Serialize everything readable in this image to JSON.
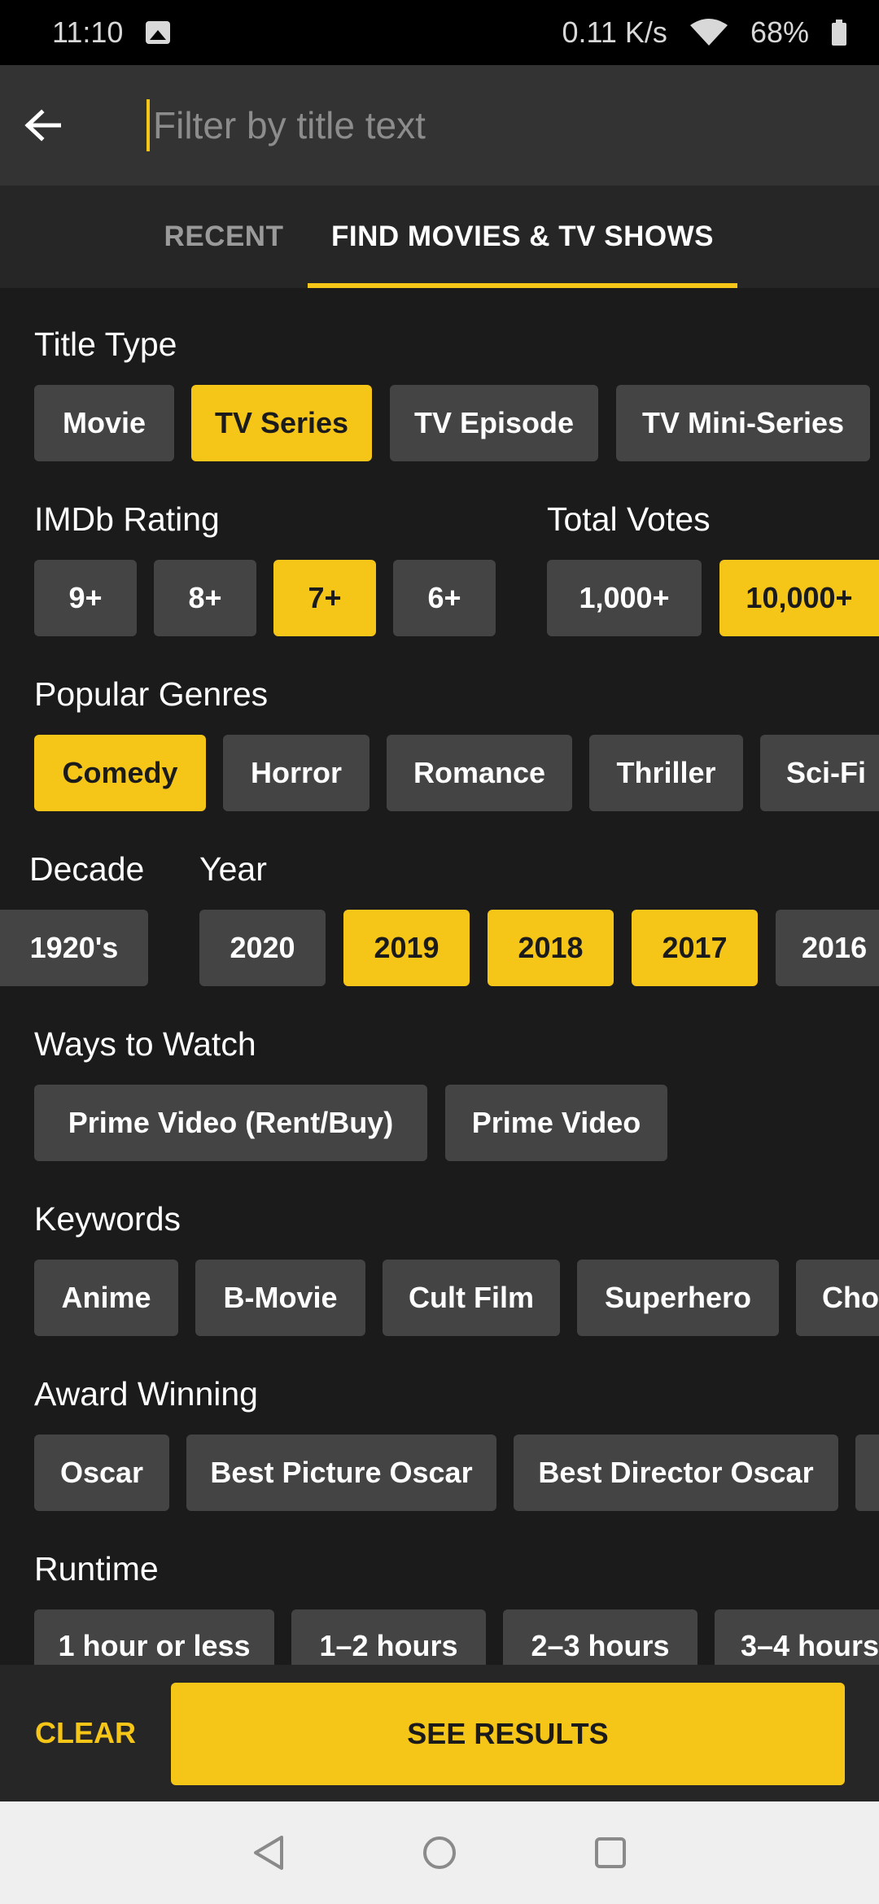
{
  "status_bar": {
    "time": "11:10",
    "speed": "0.11 K/s",
    "battery": "68%",
    "icons": [
      "image-icon",
      "wifi-icon",
      "battery-icon"
    ]
  },
  "search": {
    "placeholder": "Filter by title text",
    "value": ""
  },
  "tabs": [
    {
      "label": "RECENT",
      "selected": false
    },
    {
      "label": "FIND MOVIES & TV SHOWS",
      "selected": true
    }
  ],
  "sections": {
    "title_type": {
      "label": "Title Type",
      "chips": [
        {
          "label": "Movie",
          "selected": false
        },
        {
          "label": "TV Series",
          "selected": true
        },
        {
          "label": "TV Episode",
          "selected": false
        },
        {
          "label": "TV Mini-Series",
          "selected": false
        }
      ]
    },
    "imdb_rating": {
      "label": "IMDb Rating",
      "chips": [
        {
          "label": "9+",
          "selected": false
        },
        {
          "label": "8+",
          "selected": false
        },
        {
          "label": "7+",
          "selected": true
        },
        {
          "label": "6+",
          "selected": false
        }
      ]
    },
    "total_votes": {
      "label": "Total Votes",
      "chips": [
        {
          "label": "1,000+",
          "selected": false
        },
        {
          "label": "10,000+",
          "selected": true
        }
      ]
    },
    "popular_genres": {
      "label": "Popular Genres",
      "chips": [
        {
          "label": "Comedy",
          "selected": true
        },
        {
          "label": "Horror",
          "selected": false
        },
        {
          "label": "Romance",
          "selected": false
        },
        {
          "label": "Thriller",
          "selected": false
        },
        {
          "label": "Sci-Fi",
          "selected": false
        }
      ]
    },
    "decade": {
      "label": "Decade",
      "chips": [
        {
          "label": "1920's",
          "selected": false
        }
      ]
    },
    "year": {
      "label": "Year",
      "chips": [
        {
          "label": "2020",
          "selected": false
        },
        {
          "label": "2019",
          "selected": true
        },
        {
          "label": "2018",
          "selected": true
        },
        {
          "label": "2017",
          "selected": true
        },
        {
          "label": "2016",
          "selected": false
        }
      ]
    },
    "ways_to_watch": {
      "label": "Ways to Watch",
      "chips": [
        {
          "label": "Prime Video (Rent/Buy)",
          "selected": false
        },
        {
          "label": "Prime Video",
          "selected": false
        }
      ]
    },
    "keywords": {
      "label": "Keywords",
      "chips": [
        {
          "label": "Anime",
          "selected": false
        },
        {
          "label": "B-Movie",
          "selected": false
        },
        {
          "label": "Cult Film",
          "selected": false
        },
        {
          "label": "Superhero",
          "selected": false
        },
        {
          "label": "Cho",
          "selected": false
        }
      ]
    },
    "award_winning": {
      "label": "Award Winning",
      "chips": [
        {
          "label": "Oscar",
          "selected": false
        },
        {
          "label": "Best Picture Oscar",
          "selected": false
        },
        {
          "label": "Best Director Oscar",
          "selected": false
        }
      ]
    },
    "runtime": {
      "label": "Runtime",
      "chips": [
        {
          "label": "1 hour or less",
          "selected": false
        },
        {
          "label": "1–2 hours",
          "selected": false
        },
        {
          "label": "2–3 hours",
          "selected": false
        },
        {
          "label": "3–4 hours",
          "selected": false
        }
      ]
    }
  },
  "actions": {
    "clear": "CLEAR",
    "see_results": "SEE RESULTS"
  },
  "nav": [
    "back-nav-icon",
    "home-nav-icon",
    "recents-nav-icon"
  ],
  "colors": {
    "accent": "#f5c518",
    "background": "#1b1b1b",
    "chip": "#444444"
  }
}
